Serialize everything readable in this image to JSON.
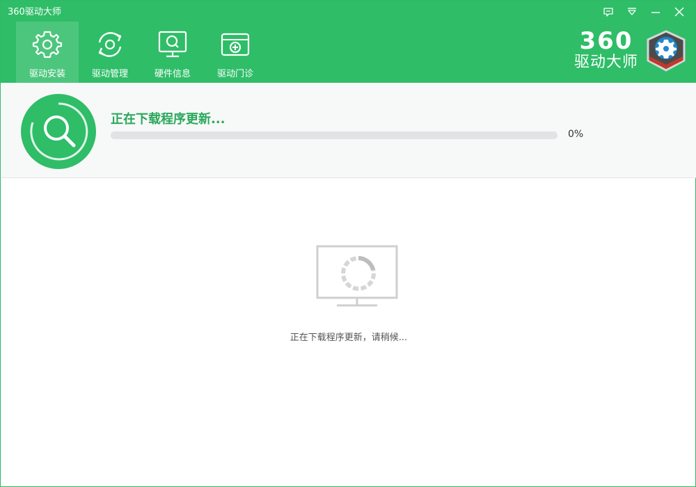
{
  "window": {
    "title": "360驱动大师"
  },
  "controls": {
    "feedback_icon": "feedback-icon",
    "menu_icon": "dropdown-menu-icon",
    "minimize_icon": "minimize-icon",
    "close_icon": "close-icon"
  },
  "tabs": [
    {
      "label": "驱动安装",
      "icon": "gear-icon",
      "active": true
    },
    {
      "label": "驱动管理",
      "icon": "refresh-gear-icon",
      "active": false
    },
    {
      "label": "硬件信息",
      "icon": "monitor-search-icon",
      "active": false
    },
    {
      "label": "驱动门诊",
      "icon": "medical-kit-icon",
      "active": false
    }
  ],
  "brand": {
    "number": "360",
    "name": "驱动大师"
  },
  "progress": {
    "title": "正在下载程序更新...",
    "percent_label": "0%",
    "fraction": 0.0
  },
  "center": {
    "message": "正在下载程序更新，请稍候..."
  },
  "colors": {
    "accent": "#2fbd68",
    "accent_text": "#2aa85a"
  }
}
